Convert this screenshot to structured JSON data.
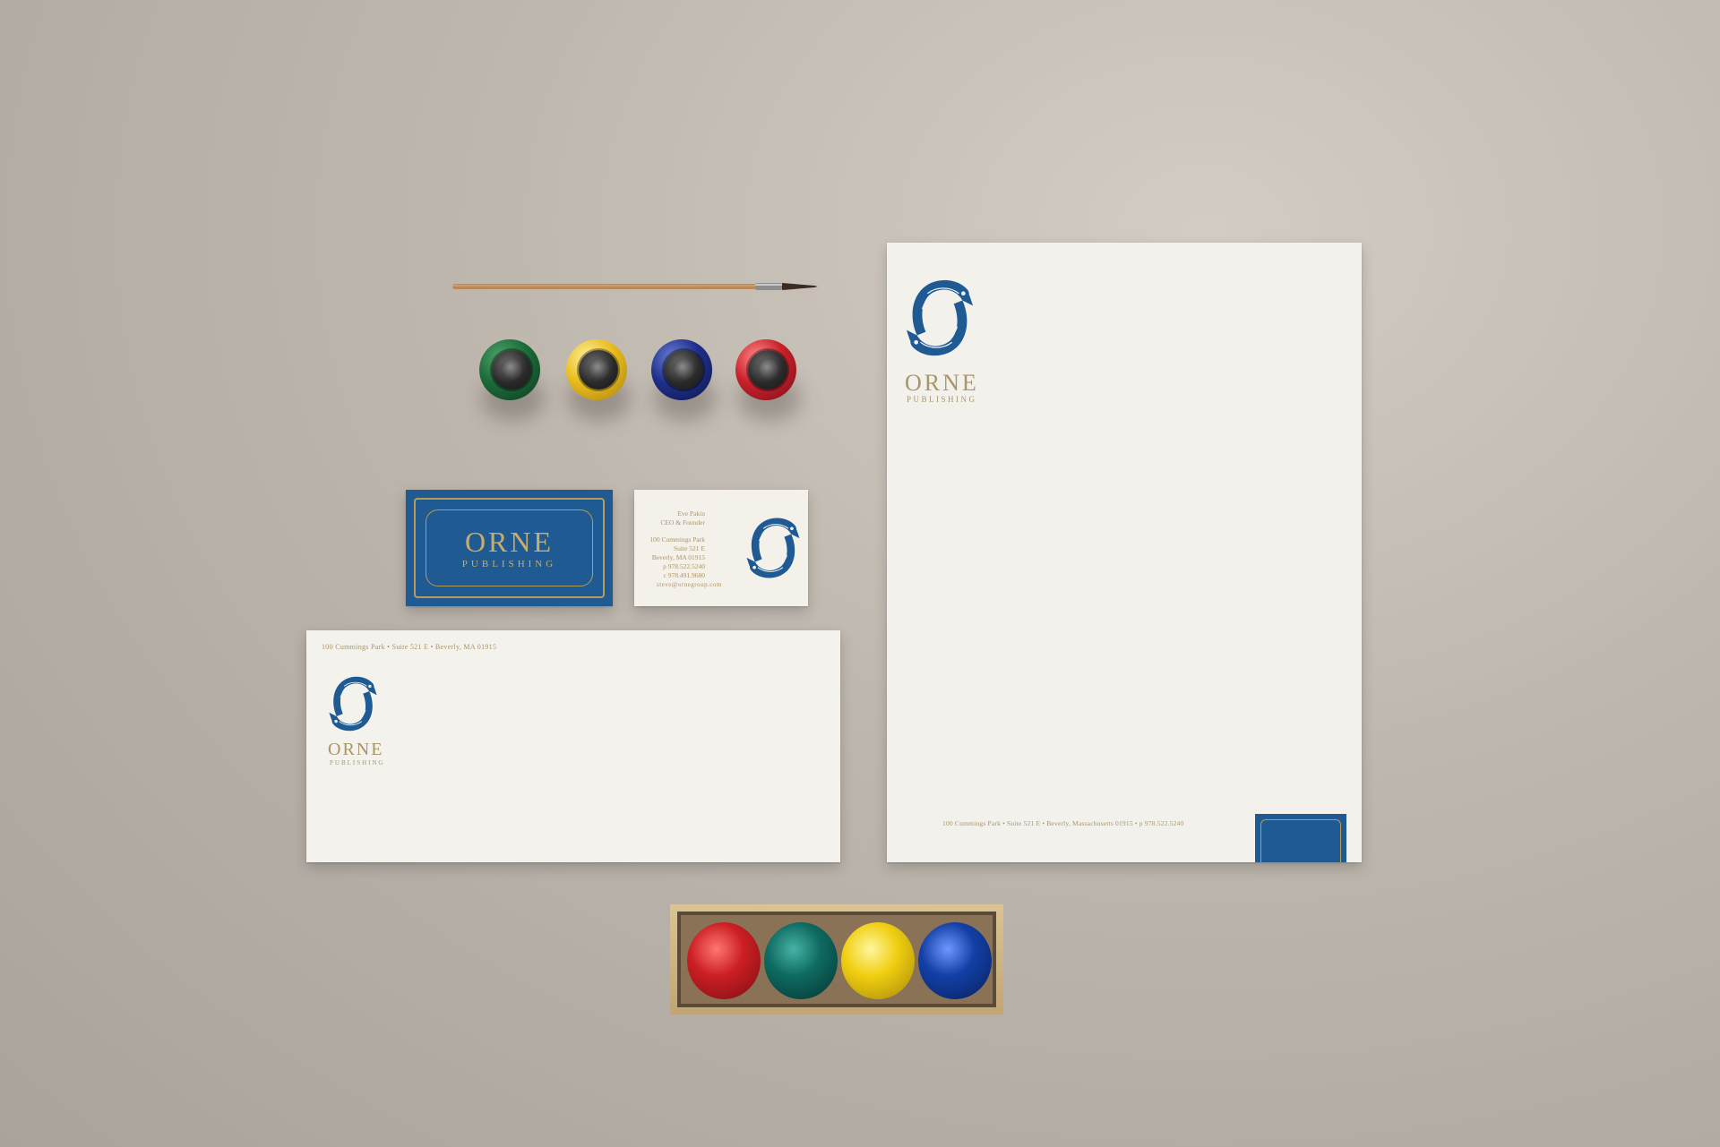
{
  "brand": {
    "name": "ORNE",
    "subtitle": "PUBLISHING",
    "colors": {
      "navy": "#1f5a92",
      "gold": "#b79b56",
      "paper": "#f3f2ed",
      "background": "#bdb6ad"
    }
  },
  "business_card_back": {
    "name": "Eve Pakin",
    "title": "CEO & Founder",
    "address_1": "100 Cummings Park",
    "address_2": "Suite 521 E",
    "address_3": "Beverly, MA 01915",
    "phone": "p 978.522.5240",
    "cell": "c 978.491.9680",
    "email": "steve@ornegroup.com"
  },
  "envelope": {
    "return_address": "100 Cummings Park • Suite 521 E • Beverly, MA 01915"
  },
  "letterhead": {
    "footer": "100 Cummings Park • Suite 521 E • Beverly, Massachusetts 01915 • p 978.522.5240"
  },
  "ink_bottles_top": [
    {
      "color": "#1d6b3a",
      "icon": "green-ink-bottle"
    },
    {
      "color": "#e0b51c",
      "icon": "yellow-ink-bottle"
    },
    {
      "color": "#1e2f8a",
      "icon": "blue-ink-bottle"
    },
    {
      "color": "#c8212a",
      "icon": "red-ink-bottle"
    }
  ],
  "ink_jars_box": [
    {
      "color": "#cc1f24",
      "icon": "red-ink-jar"
    },
    {
      "color": "#0e6b62",
      "icon": "teal-ink-jar"
    },
    {
      "color": "#f0cf12",
      "icon": "yellow-ink-jar"
    },
    {
      "color": "#1340a6",
      "icon": "blue-ink-jar"
    }
  ]
}
